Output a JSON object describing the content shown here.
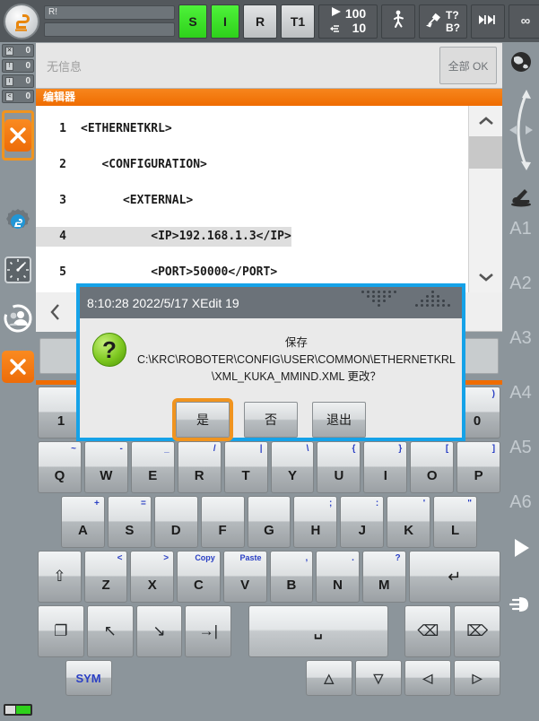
{
  "header": {
    "logo_icon": "kuka-robot-logo-icon",
    "field_top": "R!",
    "field_bottom": "",
    "status_s": "S",
    "status_i": "I",
    "status_r": "R",
    "mode": "T1",
    "speed_program": "100",
    "speed_jog": "10",
    "play_icon": "play-icon",
    "hand-icon": "hand-jog-icon",
    "walk_icon": "walking-figure-icon",
    "tool_icon": "tool-icon",
    "tool_t": "T?",
    "tool_b": "B?",
    "step_icon": "increment-step-icon",
    "infinity": "∞"
  },
  "left_rail": {
    "counters": [
      {
        "icon": "error-message-icon",
        "value": "0"
      },
      {
        "icon": "warning-message-icon",
        "value": "0"
      },
      {
        "icon": "info-message-icon",
        "value": "0"
      },
      {
        "icon": "wait-message-icon",
        "value": "0"
      }
    ],
    "stop_button_label": "✕",
    "gear_icon": "settings-gear-robot-icon",
    "clock_icon": "clock-icon",
    "user_icon": "user-group-icon",
    "close_button_label": "✕"
  },
  "right_rail": {
    "globe_icon": "world-coordinate-globe-icon",
    "jog_icon": "jog-arrows-icon",
    "robot_icon": "robot-axis-icon",
    "axes": [
      "A1",
      "A2",
      "A3",
      "A4",
      "A5",
      "A6"
    ],
    "play_icon": "play-triangle-icon",
    "hand_icon": "hand-icon"
  },
  "message_bar": {
    "text": "无信息",
    "ok_button": "全部 OK"
  },
  "editor": {
    "title": "编辑器",
    "lines": [
      {
        "num": "1",
        "text": "<ETHERNETKRL>",
        "selected": false
      },
      {
        "num": "2",
        "text": "   <CONFIGURATION>",
        "selected": false
      },
      {
        "num": "3",
        "text": "      <EXTERNAL>",
        "selected": false
      },
      {
        "num": "4",
        "text": "          <IP>192.168.1.3</IP>",
        "selected": true
      },
      {
        "num": "5",
        "text": "          <PORT>50000</PORT>",
        "selected": false
      }
    ],
    "scroll_up_icon": "chevron-up-icon",
    "scroll_down_icon": "chevron-down-icon",
    "nav_back_icon": "chevron-left-icon"
  },
  "dialog": {
    "title": "8:10:28 2022/5/17 XEdit 19",
    "question_icon": "question-mark-icon",
    "message_line1": "保存 C:\\KRC\\ROBOTER\\CONFIG\\USER\\COMMON\\ETHERNETKRL",
    "message_line2": "\\XML_KUKA_MMIND.XML 更改？",
    "buttons": [
      {
        "label": "是",
        "focused": true
      },
      {
        "label": "否",
        "focused": false
      },
      {
        "label": "退出",
        "focused": false
      }
    ],
    "border_color": "#15a2e8",
    "focus_color": "#f0941f"
  },
  "keyboard": {
    "row_numbers": [
      {
        "key": "1",
        "sup": ""
      },
      {
        "key": "0",
        "sup": ")"
      }
    ],
    "row_qwerty": [
      {
        "key": "Q",
        "sup": "~"
      },
      {
        "key": "W",
        "sup": "-"
      },
      {
        "key": "E",
        "sup": "_"
      },
      {
        "key": "R",
        "sup": "/"
      },
      {
        "key": "T",
        "sup": "|"
      },
      {
        "key": "Y",
        "sup": "\\"
      },
      {
        "key": "U",
        "sup": "{"
      },
      {
        "key": "I",
        "sup": "}"
      },
      {
        "key": "O",
        "sup": "["
      },
      {
        "key": "P",
        "sup": "]"
      }
    ],
    "row_asdf": [
      {
        "key": "A",
        "sup": "+"
      },
      {
        "key": "S",
        "sup": "="
      },
      {
        "key": "D",
        "sup": ""
      },
      {
        "key": "F",
        "sup": ""
      },
      {
        "key": "G",
        "sup": ""
      },
      {
        "key": "H",
        "sup": ";"
      },
      {
        "key": "J",
        "sup": ":"
      },
      {
        "key": "K",
        "sup": "'"
      },
      {
        "key": "L",
        "sup": "\""
      }
    ],
    "row_zxcv": [
      {
        "key": "⇧",
        "sup": "",
        "name": "shift-key"
      },
      {
        "key": "Z",
        "sup": "<"
      },
      {
        "key": "X",
        "sup": ">"
      },
      {
        "key": "C",
        "sup": "Copy"
      },
      {
        "key": "V",
        "sup": "Paste"
      },
      {
        "key": "B",
        "sup": ","
      },
      {
        "key": "N",
        "sup": "."
      },
      {
        "key": "M",
        "sup": "?"
      },
      {
        "key": "↵",
        "sup": "",
        "name": "enter-key"
      }
    ],
    "row_bottom": [
      {
        "key": "❐",
        "name": "duplicate-key"
      },
      {
        "key": "↖",
        "name": "home-key"
      },
      {
        "key": "↘",
        "name": "end-key"
      },
      {
        "key": "→|",
        "name": "tab-key"
      },
      {
        "key": "␣",
        "name": "space-key"
      },
      {
        "key": "⌫",
        "name": "backspace-key"
      },
      {
        "key": "⌦",
        "name": "delete-key"
      }
    ],
    "row_last": [
      {
        "key": "SYM",
        "name": "sym-key"
      },
      {
        "key": "△",
        "name": "arrow-up-key"
      },
      {
        "key": "▽",
        "name": "arrow-down-key"
      },
      {
        "key": "◁",
        "name": "arrow-left-key"
      },
      {
        "key": "▷",
        "name": "arrow-right-key"
      }
    ]
  },
  "status": {
    "battery_icon": "battery-indicator"
  }
}
